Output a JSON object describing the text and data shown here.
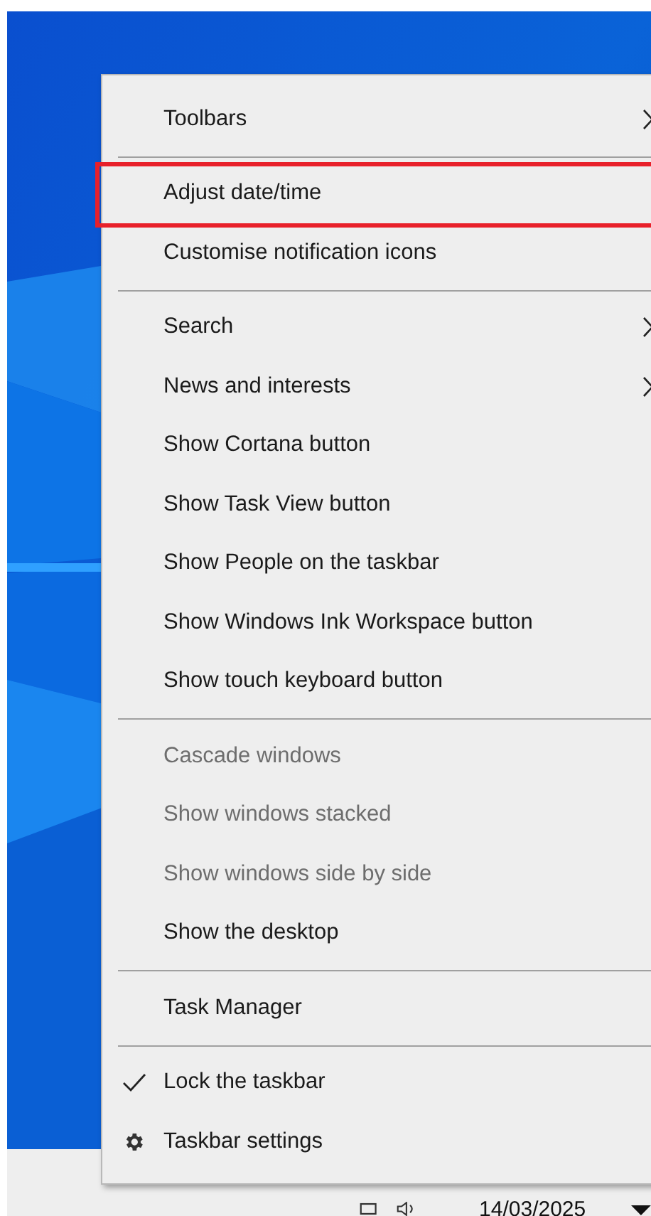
{
  "context_menu": {
    "items": [
      {
        "kind": "item",
        "label": "Toolbars",
        "submenu": true,
        "disabled": false,
        "checked": false,
        "highlighted": false
      },
      {
        "kind": "separator"
      },
      {
        "kind": "item",
        "label": "Adjust date/time",
        "submenu": false,
        "disabled": false,
        "checked": false,
        "highlighted": true
      },
      {
        "kind": "item",
        "label": "Customise notification icons",
        "submenu": false,
        "disabled": false,
        "checked": false,
        "highlighted": false
      },
      {
        "kind": "separator"
      },
      {
        "kind": "item",
        "label": "Search",
        "submenu": true,
        "disabled": false,
        "checked": false,
        "highlighted": false
      },
      {
        "kind": "item",
        "label": "News and interests",
        "submenu": true,
        "disabled": false,
        "checked": false,
        "highlighted": false
      },
      {
        "kind": "item",
        "label": "Show Cortana button",
        "submenu": false,
        "disabled": false,
        "checked": false,
        "highlighted": false
      },
      {
        "kind": "item",
        "label": "Show Task View button",
        "submenu": false,
        "disabled": false,
        "checked": false,
        "highlighted": false
      },
      {
        "kind": "item",
        "label": "Show People on the taskbar",
        "submenu": false,
        "disabled": false,
        "checked": false,
        "highlighted": false
      },
      {
        "kind": "item",
        "label": "Show Windows Ink Workspace button",
        "submenu": false,
        "disabled": false,
        "checked": false,
        "highlighted": false
      },
      {
        "kind": "item",
        "label": "Show touch keyboard button",
        "submenu": false,
        "disabled": false,
        "checked": false,
        "highlighted": false
      },
      {
        "kind": "separator"
      },
      {
        "kind": "item",
        "label": "Cascade windows",
        "submenu": false,
        "disabled": true,
        "checked": false,
        "highlighted": false
      },
      {
        "kind": "item",
        "label": "Show windows stacked",
        "submenu": false,
        "disabled": true,
        "checked": false,
        "highlighted": false
      },
      {
        "kind": "item",
        "label": "Show windows side by side",
        "submenu": false,
        "disabled": true,
        "checked": false,
        "highlighted": false
      },
      {
        "kind": "item",
        "label": "Show the desktop",
        "submenu": false,
        "disabled": false,
        "checked": false,
        "highlighted": false
      },
      {
        "kind": "separator"
      },
      {
        "kind": "item",
        "label": "Task Manager",
        "submenu": false,
        "disabled": false,
        "checked": false,
        "highlighted": false
      },
      {
        "kind": "separator"
      },
      {
        "kind": "item",
        "label": "Lock the taskbar",
        "submenu": false,
        "disabled": false,
        "checked": true,
        "highlighted": false
      },
      {
        "kind": "settings",
        "label": "Taskbar settings",
        "submenu": false,
        "disabled": false,
        "checked": false,
        "highlighted": false
      }
    ]
  },
  "taskbar": {
    "date": "14/03/2025"
  }
}
